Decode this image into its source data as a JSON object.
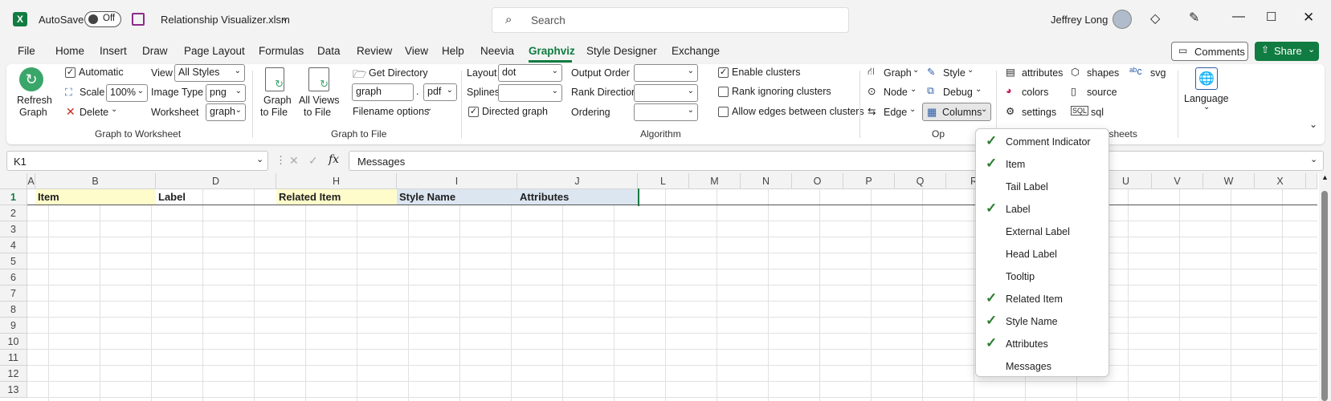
{
  "titlebar": {
    "autosave_label": "AutoSave",
    "autosave_state": "Off",
    "filename": "Relationship Visualizer.xlsm",
    "search_placeholder": "Search",
    "user_name": "Jeffrey Long"
  },
  "menu": [
    "File",
    "Home",
    "Insert",
    "Draw",
    "Page Layout",
    "Formulas",
    "Data",
    "Review",
    "View",
    "Help",
    "Neevia",
    "Graphviz",
    "Style Designer",
    "Exchange"
  ],
  "menu_active": "Graphviz",
  "actions": {
    "comments": "Comments",
    "share": "Share"
  },
  "ribbon": {
    "refresh": [
      "Refresh",
      "Graph"
    ],
    "automatic": "Automatic",
    "scale_label": "Scale",
    "scale_value": "100%",
    "delete_label": "Delete",
    "view_label": "View",
    "view_value": "All Styles",
    "image_type_label": "Image Type",
    "image_type_value": "png",
    "worksheet_label": "Worksheet",
    "worksheet_value": "graph",
    "group_graph_to_worksheet": "Graph to Worksheet",
    "graph_to_file": [
      "Graph",
      "to File"
    ],
    "all_views_to_file": [
      "All Views",
      "to File"
    ],
    "get_directory": "Get Directory",
    "file_name_value": "graph",
    "file_ext_value": "pdf",
    "filename_options": "Filename options",
    "group_graph_to_file": "Graph to File",
    "layout_label": "Layout",
    "layout_value": "dot",
    "splines_label": "Splines",
    "directed_graph": "Directed graph",
    "output_order_label": "Output Order",
    "rank_direction_label": "Rank Direction",
    "ordering_label": "Ordering",
    "enable_clusters": "Enable clusters",
    "rank_ignoring_clusters": "Rank ignoring clusters",
    "allow_edges_between_clusters": "Allow edges between clusters",
    "group_algorithm": "Algorithm",
    "graph": "Graph",
    "node": "Node",
    "edge": "Edge",
    "style": "Style",
    "debug": "Debug",
    "columns": "Columns",
    "group_options_partial": "Op",
    "attributes": "attributes",
    "colors": "colors",
    "settings": "settings",
    "shapes": "shapes",
    "source": "source",
    "sql": "sql",
    "svg": "svg",
    "group_show_hide_partial": "ow/Hide Worksheets",
    "language": "Language"
  },
  "formula": {
    "name_box": "K1",
    "fx": "fx",
    "content": "Messages"
  },
  "columns": [
    "A",
    "B",
    "D",
    "H",
    "I",
    "J",
    "L",
    "M",
    "N",
    "O",
    "P",
    "Q",
    "R",
    "U",
    "V",
    "W",
    "X"
  ],
  "header_row": [
    "Item",
    "Label",
    "Related Item",
    "Style Name",
    "Attributes"
  ],
  "rows": [
    "1",
    "2",
    "3",
    "4",
    "5",
    "6",
    "7",
    "8",
    "9",
    "10",
    "11",
    "12",
    "13"
  ],
  "dropdown": [
    {
      "label": "Comment Indicator",
      "checked": true
    },
    {
      "label": "Item",
      "checked": true
    },
    {
      "label": "Tail Label",
      "checked": false
    },
    {
      "label": "Label",
      "checked": true
    },
    {
      "label": "External Label",
      "checked": false
    },
    {
      "label": "Head Label",
      "checked": false
    },
    {
      "label": "Tooltip",
      "checked": false
    },
    {
      "label": "Related Item",
      "checked": true
    },
    {
      "label": "Style Name",
      "checked": true
    },
    {
      "label": "Attributes",
      "checked": true
    },
    {
      "label": "Messages",
      "checked": false
    }
  ],
  "colors": {
    "excel_green": "#107c41",
    "accent": "#107c41",
    "selected_cell": "#cfe8d5",
    "yellow_header": "#fffccc",
    "blue_header": "#dce6f1"
  }
}
